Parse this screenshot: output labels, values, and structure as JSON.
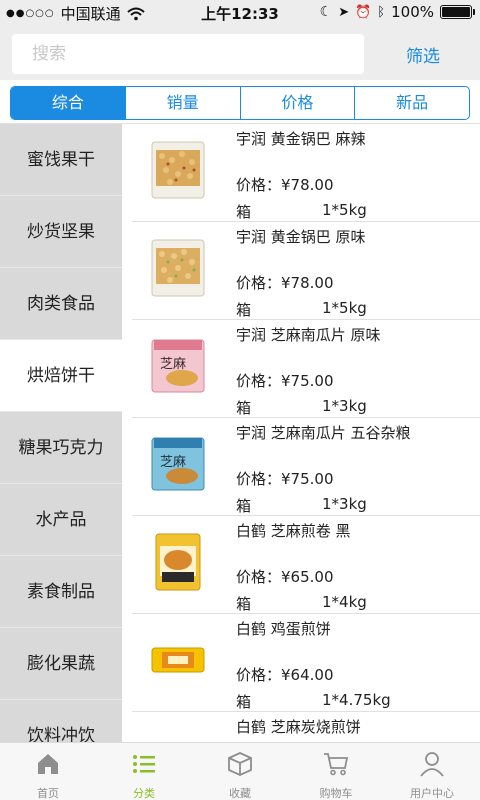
{
  "status_bar": {
    "carrier": "中国联通",
    "time": "上午12:33",
    "battery": "100%",
    "battery_level": 1.0
  },
  "search": {
    "placeholder": "搜索",
    "filter_label": "筛选"
  },
  "sort_tabs": [
    {
      "label": "综合",
      "active": true
    },
    {
      "label": "销量",
      "active": false
    },
    {
      "label": "价格",
      "active": false
    },
    {
      "label": "新品",
      "active": false
    }
  ],
  "categories": [
    {
      "label": "蜜饯果干",
      "active": false
    },
    {
      "label": "炒货坚果",
      "active": false
    },
    {
      "label": "肉类食品",
      "active": false
    },
    {
      "label": "烘焙饼干",
      "active": true
    },
    {
      "label": "糖果巧克力",
      "active": false
    },
    {
      "label": "水产品",
      "active": false
    },
    {
      "label": "素食制品",
      "active": false
    },
    {
      "label": "膨化果蔬",
      "active": false
    },
    {
      "label": "饮料冲饮",
      "active": false
    }
  ],
  "products": [
    {
      "name": "宇润  黄金锅巴 麻辣",
      "price": "价格：¥78.00",
      "unit": "箱",
      "spec": "1*5kg",
      "thumb": "golden-crisp"
    },
    {
      "name": "宇润  黄金锅巴 原味",
      "price": "价格：¥78.00",
      "unit": "箱",
      "spec": "1*5kg",
      "thumb": "golden-crisp"
    },
    {
      "name": "宇润  芝麻南瓜片 原味",
      "price": "价格：¥75.00",
      "unit": "箱",
      "spec": "1*3kg",
      "thumb": "pink-pack"
    },
    {
      "name": "宇润  芝麻南瓜片 五谷杂粮",
      "price": "价格：¥75.00",
      "unit": "箱",
      "spec": "1*3kg",
      "thumb": "blue-pack"
    },
    {
      "name": "白鹤  芝麻煎卷 黑",
      "price": "价格：¥65.00",
      "unit": "箱",
      "spec": "1*4kg",
      "thumb": "yellow-roll"
    },
    {
      "name": "白鹤  鸡蛋煎饼",
      "price": "价格：¥64.00",
      "unit": "箱",
      "spec": "1*4.75kg",
      "thumb": "yellow-bar"
    },
    {
      "name": "白鹤  芝麻炭烧煎饼",
      "price": "",
      "unit": "",
      "spec": "",
      "thumb": ""
    }
  ],
  "tabbar": [
    {
      "label": "首页",
      "icon": "home-icon",
      "active": false
    },
    {
      "label": "分类",
      "icon": "list-icon",
      "active": true
    },
    {
      "label": "收藏",
      "icon": "box-icon",
      "active": false
    },
    {
      "label": "购物车",
      "icon": "cart-icon",
      "active": false
    },
    {
      "label": "用户中心",
      "icon": "user-icon",
      "active": false
    }
  ],
  "colors": {
    "accent": "#1a8be0",
    "tab_active": "#8bbf2a",
    "tab_inactive": "#8e8e8e",
    "sidebar_bg": "#d9d9d9"
  }
}
